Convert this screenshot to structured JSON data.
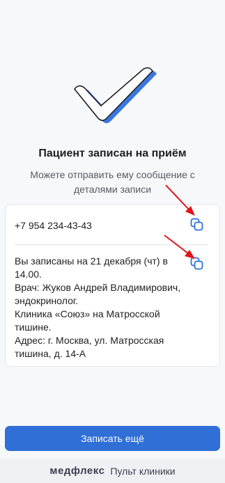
{
  "confirmation": {
    "title": "Пациент записан на приём",
    "subtitle": "Можете отправить ему сообщение с деталями записи"
  },
  "card": {
    "phone": "+7 954 234-43-43",
    "message": "Вы записаны на 21 декабря (чт) в 14.00.\nВрач: Жуков Андрей Владимирович, эндокринолог.\nКлиника «Союз» на Матросской тишине.\nАдрес: г. Москва, ул. Матросская тишина, д. 14-А",
    "copy_icon": "copy-icon"
  },
  "actions": {
    "book_again_label": "Записать ещё"
  },
  "footer": {
    "brand": "медфлекс",
    "label": "Пульт клиники"
  },
  "colors": {
    "accent": "#2f6fd6",
    "arrow": "#e3131b"
  }
}
